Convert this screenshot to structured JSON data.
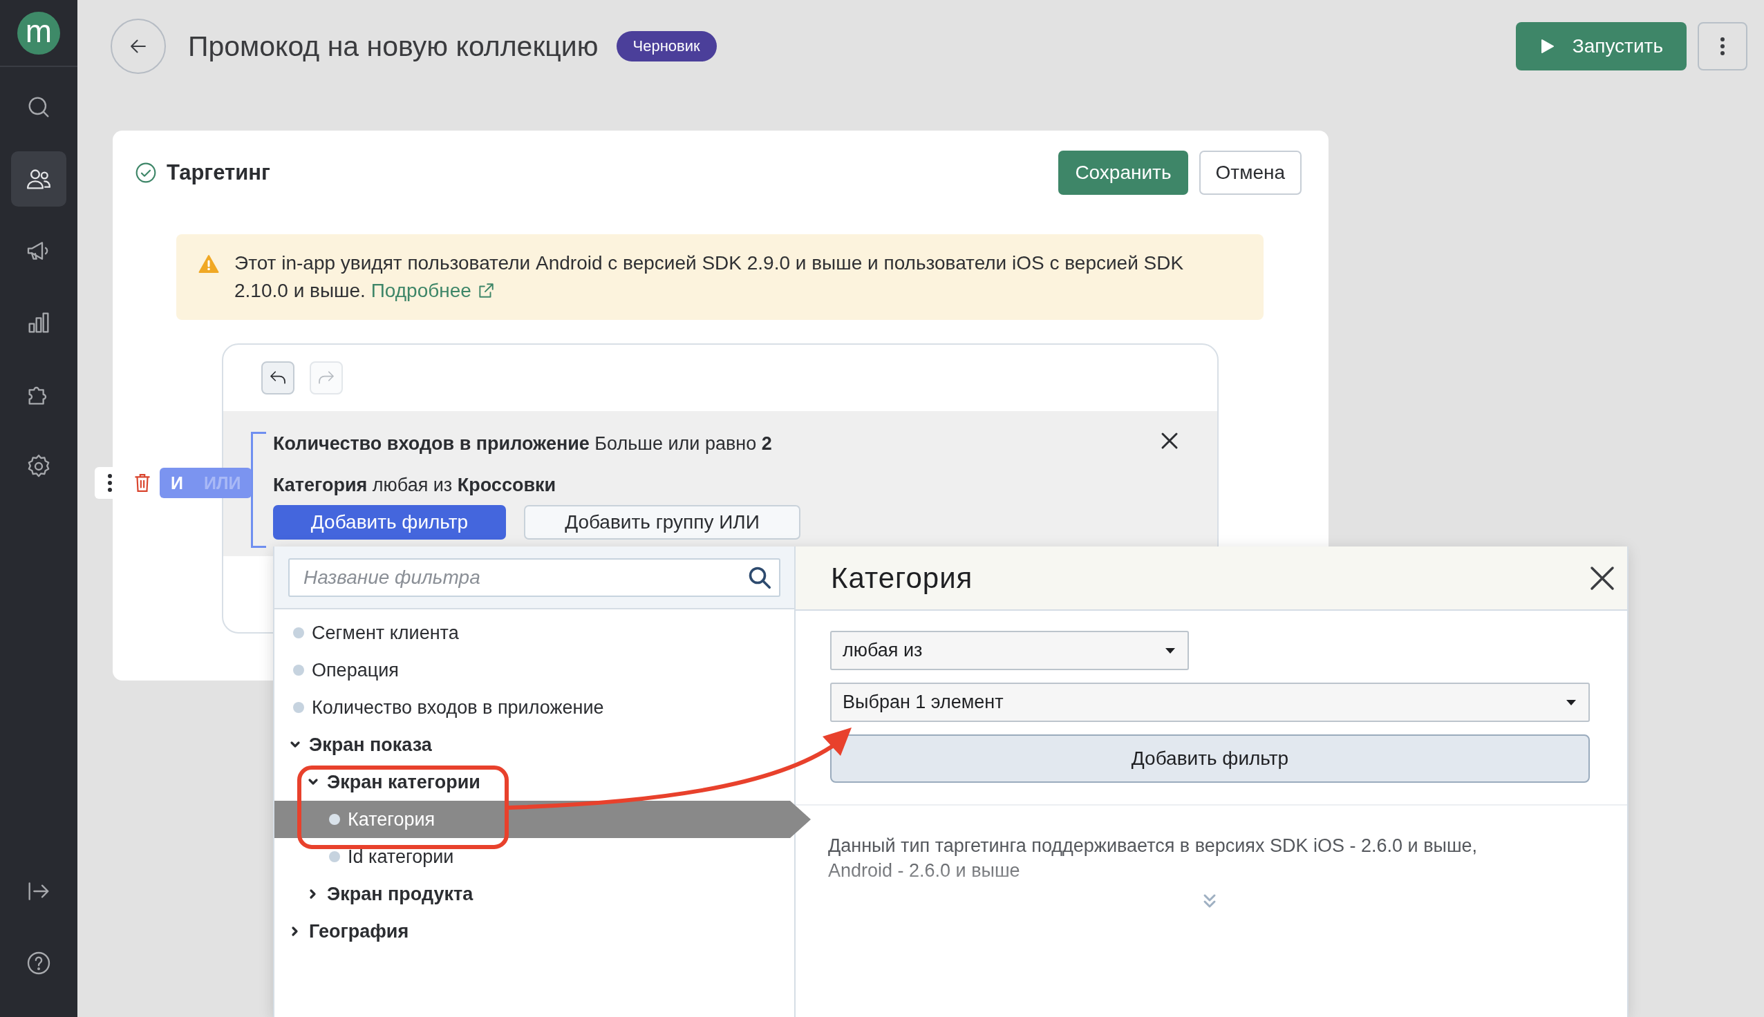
{
  "sidebar": {
    "logo": "m",
    "items": [
      {
        "selected": false
      },
      {
        "selected": true
      },
      {
        "selected": false
      },
      {
        "selected": false
      },
      {
        "selected": false
      },
      {
        "selected": false
      }
    ]
  },
  "header": {
    "title": "Промокод на новую коллекцию",
    "status_badge": "Черновик",
    "run_button": "Запустить"
  },
  "targeting": {
    "title": "Таргетинг",
    "save_button": "Сохранить",
    "cancel_button": "Отмена",
    "notice": {
      "text": "Этот in-app увидят пользователи Android с версией SDK 2.9.0 и выше и пользователи iOS с версией SDK 2.10.0 и выше.",
      "link": "Подробнее"
    },
    "builder": {
      "undo": {
        "disabled": false
      },
      "redo": {
        "disabled": true
      },
      "operators": [
        {
          "label": "И",
          "selected": true
        },
        {
          "label": "ИЛИ",
          "selected": false
        }
      ],
      "conditions": [
        {
          "text": "**Количество входов в приложение** Больше или равно **2**"
        },
        {
          "text": "**Категория** любая из **Кроссовки**"
        }
      ],
      "add_filter_button": "Добавить фильтр",
      "add_group_button": "Добавить группу ИЛИ"
    }
  },
  "filter_picker": {
    "search": {
      "placeholder": "Название фильтра"
    },
    "tree": [
      {
        "kind": "leaf",
        "label": "Сегмент клиента",
        "selected": false
      },
      {
        "kind": "leaf",
        "label": "Операция",
        "selected": false
      },
      {
        "kind": "leaf",
        "label": "Количество входов в приложение",
        "selected": false
      },
      {
        "kind": "group",
        "label": "Экран показа",
        "expanded": true,
        "children": [
          {
            "kind": "group",
            "label": "Экран категории",
            "expanded": true,
            "children": [
              {
                "kind": "leaf",
                "label": "Категория",
                "selected": true
              },
              {
                "kind": "leaf",
                "label": "Id категории",
                "selected": false
              }
            ]
          },
          {
            "kind": "group",
            "label": "Экран продукта",
            "expanded": false
          }
        ]
      },
      {
        "kind": "group",
        "label": "География",
        "expanded": false
      }
    ],
    "detail": {
      "title": "Категория",
      "operator_select": "любая из",
      "value_select": "Выбран 1 элемент",
      "add_button": "Добавить фильтр",
      "note": "Данный тип таргетинга поддерживается в версиях SDK iOS - 2.6.0 и выше, Android - 2.6.0 и выше"
    }
  }
}
